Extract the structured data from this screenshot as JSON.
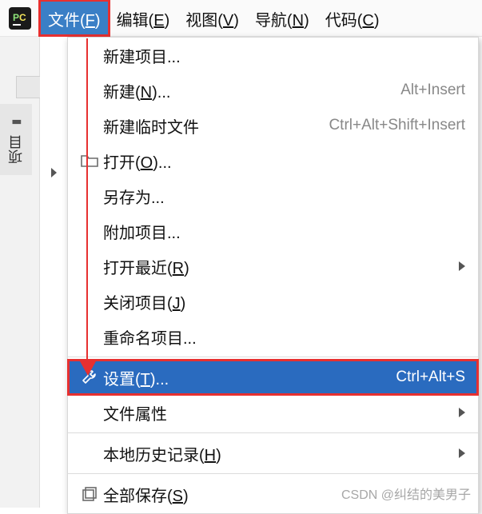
{
  "menubar": {
    "items": [
      {
        "label": "文件",
        "mnemonic": "F",
        "selected": true,
        "highlighted": true
      },
      {
        "label": "编辑",
        "mnemonic": "E",
        "selected": false,
        "highlighted": false
      },
      {
        "label": "视图",
        "mnemonic": "V",
        "selected": false,
        "highlighted": false
      },
      {
        "label": "导航",
        "mnemonic": "N",
        "selected": false,
        "highlighted": false
      },
      {
        "label": "代码",
        "mnemonic": "C",
        "selected": false,
        "highlighted": false
      }
    ]
  },
  "tool_window": {
    "project_tab": "项目"
  },
  "file_menu": {
    "groups": [
      [
        {
          "label": "新建项目...",
          "mnemonic": null,
          "shortcut": "",
          "submenu": false,
          "icon": null
        },
        {
          "label": "新建",
          "mnemonic": "N",
          "trailing": "...",
          "shortcut": "Alt+Insert",
          "submenu": false,
          "icon": null
        },
        {
          "label": "新建临时文件",
          "mnemonic": null,
          "shortcut": "Ctrl+Alt+Shift+Insert",
          "submenu": false,
          "icon": null
        },
        {
          "label": "打开",
          "mnemonic": "O",
          "trailing": "...",
          "shortcut": "",
          "submenu": false,
          "icon": "open-folder"
        },
        {
          "label": "另存为...",
          "mnemonic": null,
          "shortcut": "",
          "submenu": false,
          "icon": null
        },
        {
          "label": "附加项目...",
          "mnemonic": null,
          "shortcut": "",
          "submenu": false,
          "icon": null
        },
        {
          "label": "打开最近",
          "mnemonic": "R",
          "trailing": "",
          "shortcut": "",
          "submenu": true,
          "icon": null
        },
        {
          "label": "关闭项目",
          "mnemonic": "J",
          "trailing": "",
          "shortcut": "",
          "submenu": false,
          "icon": null
        },
        {
          "label": "重命名项目...",
          "mnemonic": null,
          "shortcut": "",
          "submenu": false,
          "icon": null
        }
      ],
      [
        {
          "label": "设置",
          "mnemonic": "T",
          "trailing": "...",
          "shortcut": "Ctrl+Alt+S",
          "submenu": false,
          "icon": "wrench",
          "selected": true,
          "highlighted": true
        },
        {
          "label": "文件属性",
          "mnemonic": null,
          "shortcut": "",
          "submenu": true,
          "icon": null
        }
      ],
      [
        {
          "label": "本地历史记录",
          "mnemonic": "H",
          "trailing": "",
          "shortcut": "",
          "submenu": true,
          "icon": null
        }
      ],
      [
        {
          "label": "全部保存",
          "mnemonic": "S",
          "trailing": "",
          "shortcut": "",
          "submenu": false,
          "icon": "save-all"
        }
      ]
    ]
  },
  "watermark": "CSDN @纠结的美男子"
}
